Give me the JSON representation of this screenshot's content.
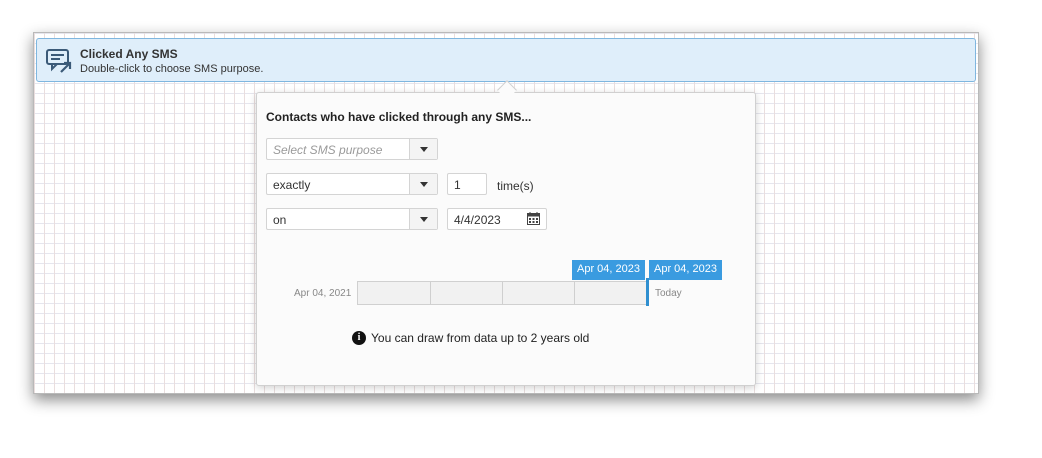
{
  "node": {
    "title": "Clicked Any SMS",
    "subtitle": "Double-click to choose SMS purpose.",
    "icon": "sms-click-icon"
  },
  "popover": {
    "title": "Contacts who have clicked through any SMS...",
    "purpose_select": {
      "placeholder": "Select SMS purpose",
      "value": ""
    },
    "frequency_select": {
      "value": "exactly"
    },
    "count_input": {
      "value": "1"
    },
    "count_suffix": "time(s)",
    "date_mode_select": {
      "value": "on"
    },
    "date_input": {
      "value": "4/4/2023",
      "icon": "calendar-icon"
    },
    "timeline": {
      "start_label": "Apr 04, 2021",
      "selected_flag": "Apr 04, 2023",
      "end_flag": "Apr 04, 2023",
      "end_label": "Today",
      "selected_fraction": 1.0
    },
    "info": {
      "icon": "info-icon",
      "text": "You can draw from data up to 2 years old"
    }
  },
  "colors": {
    "accent": "#3a9be0",
    "header_bg": "#dfeefa",
    "header_border": "#7fb6df"
  }
}
